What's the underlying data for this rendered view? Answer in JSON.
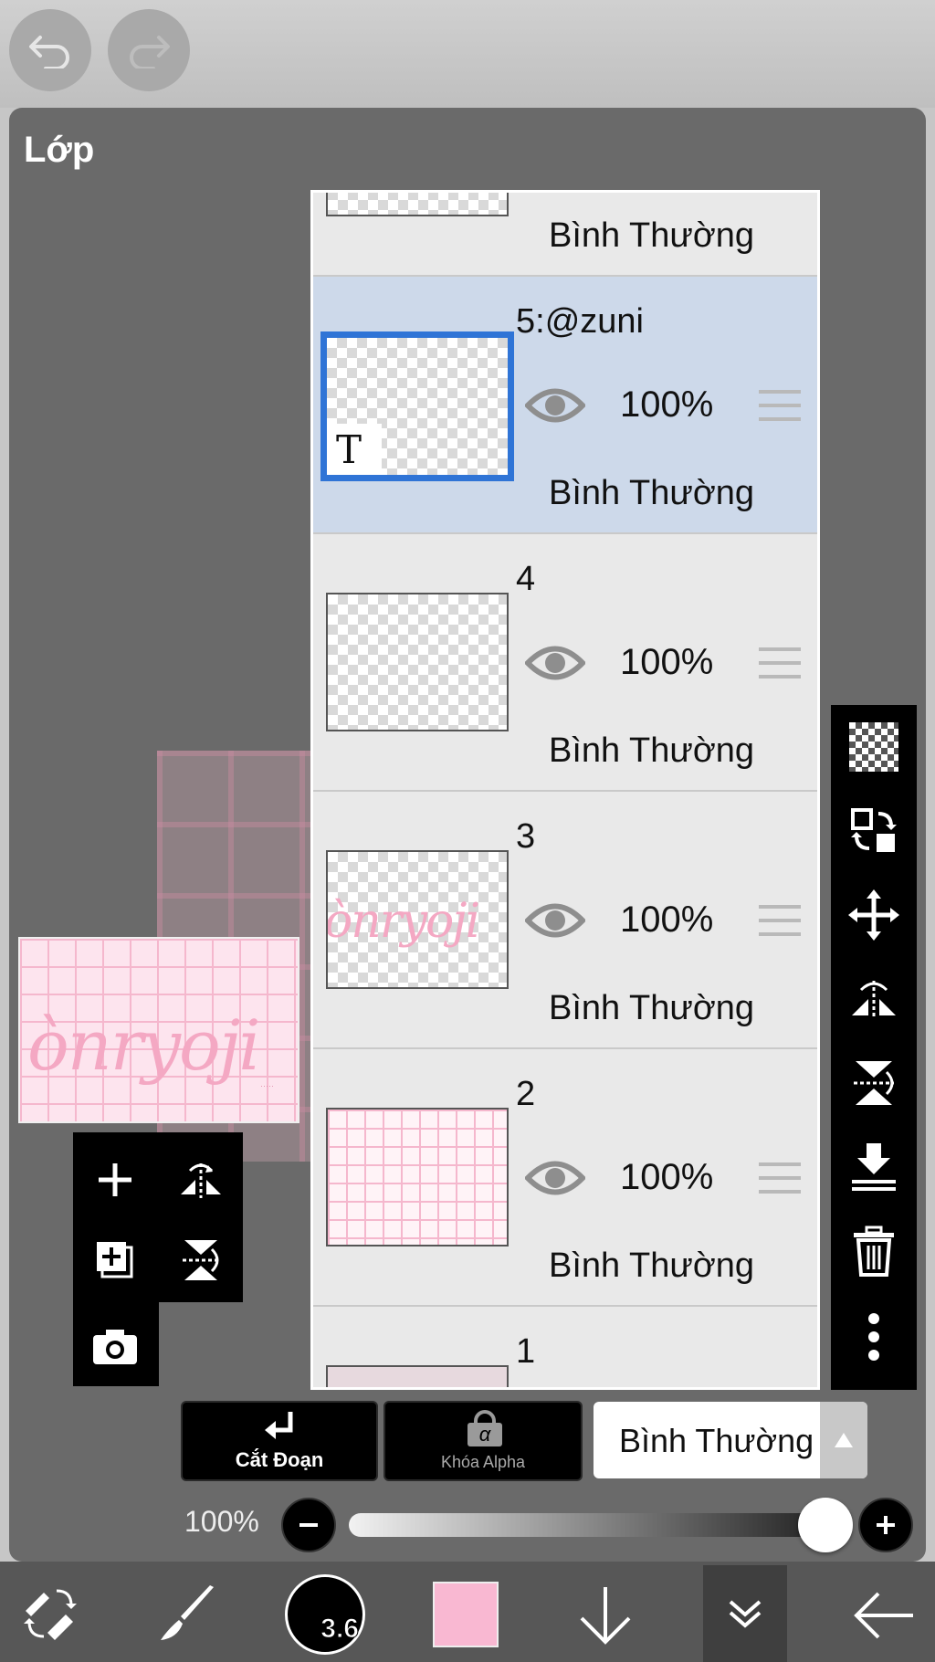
{
  "header": {
    "undo_icon": "undo-icon",
    "redo_icon": "redo-icon"
  },
  "panel": {
    "title": "Lớp"
  },
  "layers": [
    {
      "name": "",
      "opacity": "",
      "blend_mode": "Bình Thường"
    },
    {
      "name": "5:@zuni",
      "opacity": "100%",
      "blend_mode": "Bình Thường",
      "selected": true,
      "type_badge": "T"
    },
    {
      "name": "4",
      "opacity": "100%",
      "blend_mode": "Bình Thường"
    },
    {
      "name": "3",
      "opacity": "100%",
      "blend_mode": "Bình Thường"
    },
    {
      "name": "2",
      "opacity": "100%",
      "blend_mode": "Bình Thường"
    },
    {
      "name": "1"
    }
  ],
  "preview": {
    "text": "ònryoji"
  },
  "actions": {
    "clip_label": "Cắt Đoạn",
    "alpha_lock_label": "Khóa Alpha",
    "alpha_symbol": "α"
  },
  "blend_select": {
    "value": "Bình Thường"
  },
  "opacity": {
    "label": "100%",
    "value": 1.0
  },
  "brush": {
    "size": "3.6"
  },
  "colors": {
    "current": "#f9b8d2",
    "selection_border": "#2f74d6",
    "selected_row": "#cdd9ea"
  },
  "right_tools": [
    "transparent-icon",
    "swap-layers-icon",
    "move-icon",
    "flip-horizontal-icon",
    "flip-vertical-icon",
    "merge-down-icon",
    "trash-icon",
    "more-icon"
  ],
  "left_tools": [
    "add-layer-icon",
    "flip-horizontal-icon",
    "duplicate-layer-icon",
    "flip-vertical-icon",
    "camera-icon"
  ],
  "bottom_tools": [
    "tool-swap-icon",
    "brush-icon",
    "brush-size",
    "color-swatch",
    "arrow-down-icon",
    "collapse-icon",
    "back-icon"
  ]
}
